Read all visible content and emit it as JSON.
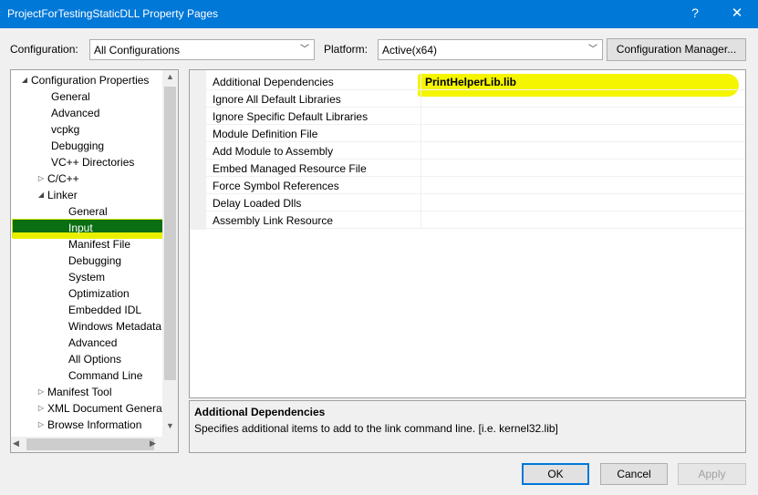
{
  "window": {
    "title": "ProjectForTestingStaticDLL Property Pages",
    "help_label": "?",
    "close_label": "✕"
  },
  "toolbar": {
    "configuration_label": "Configuration:",
    "configuration_value": "All Configurations",
    "platform_label": "Platform:",
    "platform_value": "Active(x64)",
    "config_manager_label": "Configuration Manager..."
  },
  "tree": {
    "items": [
      {
        "label": "Configuration Properties",
        "twisty": "◢"
      },
      {
        "label": "General"
      },
      {
        "label": "Advanced"
      },
      {
        "label": "vcpkg"
      },
      {
        "label": "Debugging"
      },
      {
        "label": "VC++ Directories"
      },
      {
        "label": "C/C++",
        "twisty": "▷"
      },
      {
        "label": "Linker",
        "twisty": "◢"
      },
      {
        "label": "General"
      },
      {
        "label": "Input"
      },
      {
        "label": "Manifest File"
      },
      {
        "label": "Debugging"
      },
      {
        "label": "System"
      },
      {
        "label": "Optimization"
      },
      {
        "label": "Embedded IDL"
      },
      {
        "label": "Windows Metadata"
      },
      {
        "label": "Advanced"
      },
      {
        "label": "All Options"
      },
      {
        "label": "Command Line"
      },
      {
        "label": "Manifest Tool",
        "twisty": "▷"
      },
      {
        "label": "XML Document Generator",
        "twisty": "▷"
      },
      {
        "label": "Browse Information",
        "twisty": "▷"
      }
    ]
  },
  "grid": {
    "rows": [
      {
        "name": "Additional Dependencies",
        "value": "PrintHelperLib.lib"
      },
      {
        "name": "Ignore All Default Libraries",
        "value": ""
      },
      {
        "name": "Ignore Specific Default Libraries",
        "value": ""
      },
      {
        "name": "Module Definition File",
        "value": ""
      },
      {
        "name": "Add Module to Assembly",
        "value": ""
      },
      {
        "name": "Embed Managed Resource File",
        "value": ""
      },
      {
        "name": "Force Symbol References",
        "value": ""
      },
      {
        "name": "Delay Loaded Dlls",
        "value": ""
      },
      {
        "name": "Assembly Link Resource",
        "value": ""
      }
    ]
  },
  "description": {
    "title": "Additional Dependencies",
    "text": "Specifies additional items to add to the link command line. [i.e. kernel32.lib]"
  },
  "buttons": {
    "ok": "OK",
    "cancel": "Cancel",
    "apply": "Apply"
  },
  "colors": {
    "titlebar": "#0078d7",
    "selection": "#0a6e12",
    "marker": "#f5f500"
  }
}
